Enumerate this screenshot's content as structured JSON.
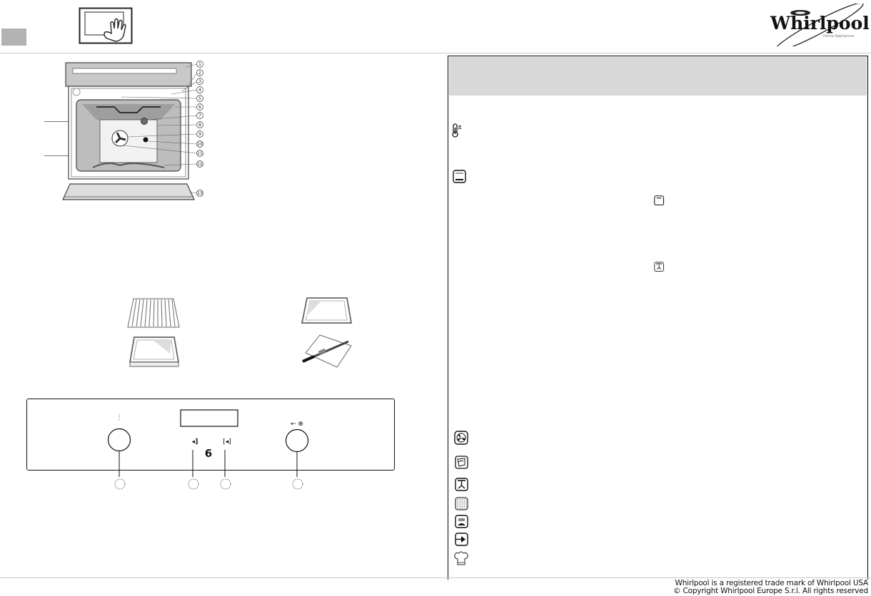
{
  "document": {
    "brand": "Whirlpool",
    "brand_tagline": "Home Appliances",
    "section_tab_color": "#b2b2b2",
    "header_band_color": "#d8d8d8"
  },
  "oven_diagram": {
    "callouts": [
      "1",
      "2",
      "3",
      "4",
      "5",
      "6",
      "7",
      "8",
      "9",
      "10",
      "11",
      "12",
      "13"
    ]
  },
  "accessories": [
    {
      "name": "wire-grid"
    },
    {
      "name": "baking-tray"
    },
    {
      "name": "drip-pan"
    },
    {
      "name": "rotisserie-spit"
    }
  ],
  "control_panel": {
    "left_knob_symbol": "⋮",
    "right_knob_symbol": "← ⊕",
    "button_left_symbol": "◂]",
    "button_right_symbol": "[◂]",
    "center_logo_symbol": "6"
  },
  "function_icons": [
    "fast-preheat-icon",
    "top-bottom-heat-icon",
    "top-heat-inline-icon",
    "grill-fan-inline-icon",
    "fan-forced-icon",
    "pastry-icon",
    "turbo-grill-icon",
    "defrost-icon",
    "bottom-heat-icon",
    "timer-set-icon",
    "chef-hat-icon"
  ],
  "footer": {
    "line1": "Whirlpool is a registered trade mark of Whirlpool USA",
    "line2": "© Copyright Whirlpool Europe S.r.l. All rights reserved"
  }
}
